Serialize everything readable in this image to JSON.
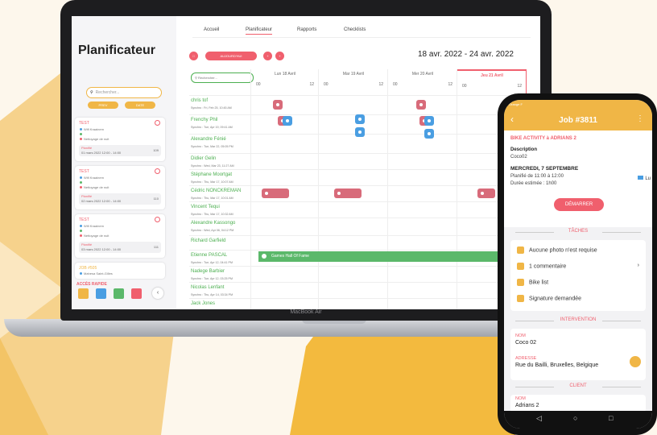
{
  "colors": {
    "accent": "#f0b646",
    "primary": "#f05f6d",
    "success": "#5bb86a",
    "blue": "#4a9ee2"
  },
  "device_label": "MacBook Air",
  "app": {
    "title": "Planificateur",
    "nav": [
      "Accueil",
      "Planificateur",
      "Rapports",
      "Checklists"
    ],
    "search_placeholder": "Rechercher...",
    "filter_a": "PREV",
    "filter_b": "DATE",
    "today_label": "AUJOURD'HUI",
    "date_range": "18 avr. 2022 - 24 avr. 2022",
    "grid_search_placeholder": "Rechercher...",
    "days": [
      {
        "label": "Lun 18 Avril"
      },
      {
        "label": "Mar 19 Avril"
      },
      {
        "label": "Mer 20 Avril"
      },
      {
        "label": "Jeu 21 Avril"
      }
    ],
    "hour_0": "00",
    "hour_12": "12",
    "cards": [
      {
        "title": "TEST",
        "line1": "Wifi Kraainem",
        "line2": "",
        "line3": "Nettoyage de nuit",
        "planned": "Planifié",
        "date": "01 mars 2022 12:00 - 14:00",
        "count": "109"
      },
      {
        "title": "TEST",
        "line1": "Wifi Kraainem",
        "line2": "",
        "line3": "Nettoyage de nuit",
        "planned": "Planifié",
        "date": "02 mars 2022 12:00 - 14:00",
        "count": "110"
      },
      {
        "title": "TEST",
        "line1": "Wifi Kraainem",
        "line2": "",
        "line3": "Nettoyage de nuit",
        "planned": "Planifié",
        "date": "03 mars 2022 12:00 - 14:00",
        "count": "111"
      },
      {
        "title": "JOB #505",
        "line1": "Mahesa Saint-Gilles",
        "line2": "",
        "line3": "",
        "planned": "",
        "date": "",
        "count": ""
      }
    ],
    "quick_access": "ACCÈS RAPIDE",
    "people": [
      {
        "name": "chris tof",
        "sync": "Synchro : Fri, Feb 25, 10:45 AM"
      },
      {
        "name": "Frenchy Phil",
        "sync": "Synchro : Tue, Apr 19, 09:41 AM"
      },
      {
        "name": "Alexandre Fénié",
        "sync": "Synchro : Tue, Mar 22, 05:05 PM"
      },
      {
        "name": "Didier Gelin",
        "sync": "Synchro : Wed, Mar 23, 11:27 AM"
      },
      {
        "name": "Stéphane Moortgat",
        "sync": "Synchro : Thu, Mar 17, 10:07 AM"
      },
      {
        "name": "Cédric NONCKREMAN",
        "sync": "Synchro : Thu, Mar 17, 10:01 AM"
      },
      {
        "name": "Vincent Tequi",
        "sync": "Synchro : Thu, Mar 17, 10:32 AM"
      },
      {
        "name": "Alexandre Kassongo",
        "sync": "Synchro : Wed, Apr 06, 04:12 PM"
      },
      {
        "name": "Richard Garfield",
        "sync": ""
      },
      {
        "name": "Etienne PASCAL",
        "sync": "Synchro : Tue, Apr 12, 04:41 PM"
      },
      {
        "name": "Nadege Barbier",
        "sync": "Synchro : Tue, Apr 12, 03:25 PM"
      },
      {
        "name": "Nicolas Lenfant",
        "sync": "Synchro : Thu, Apr 14, 03:34 PM"
      },
      {
        "name": "Jack Jones",
        "sync": ""
      }
    ],
    "event_bar": "Games Hall Of Fame"
  },
  "phone": {
    "status": "Orange F",
    "title": "Job #3811",
    "activity": "BIKE ACTIVITY à ADRIANS 2",
    "desc_label": "Description",
    "desc_value": "Coco02",
    "date_title": "MERCREDI, 7 SEPTEMBRE",
    "planned": "Planifié de 11:00 à 12:00",
    "duration": "Durée estimée : 1h00",
    "start_btn": "DÉMARRER",
    "tasks_section": "TÂCHES",
    "tasks": [
      "Aucune photo n'est requise",
      "1 commentaire",
      "Bike list",
      "Signature demandée"
    ],
    "intervention_section": "INTERVENTION",
    "nom_label": "NOM",
    "nom_value": "Coco 02",
    "address_label": "ADRESSE",
    "address_value": "Rue du Bailli, Bruxelles, Belgique",
    "client_section": "CLIENT",
    "client_nom_label": "NOM",
    "client_nom_value": "Adrians 2",
    "side_badge": "Lu"
  }
}
